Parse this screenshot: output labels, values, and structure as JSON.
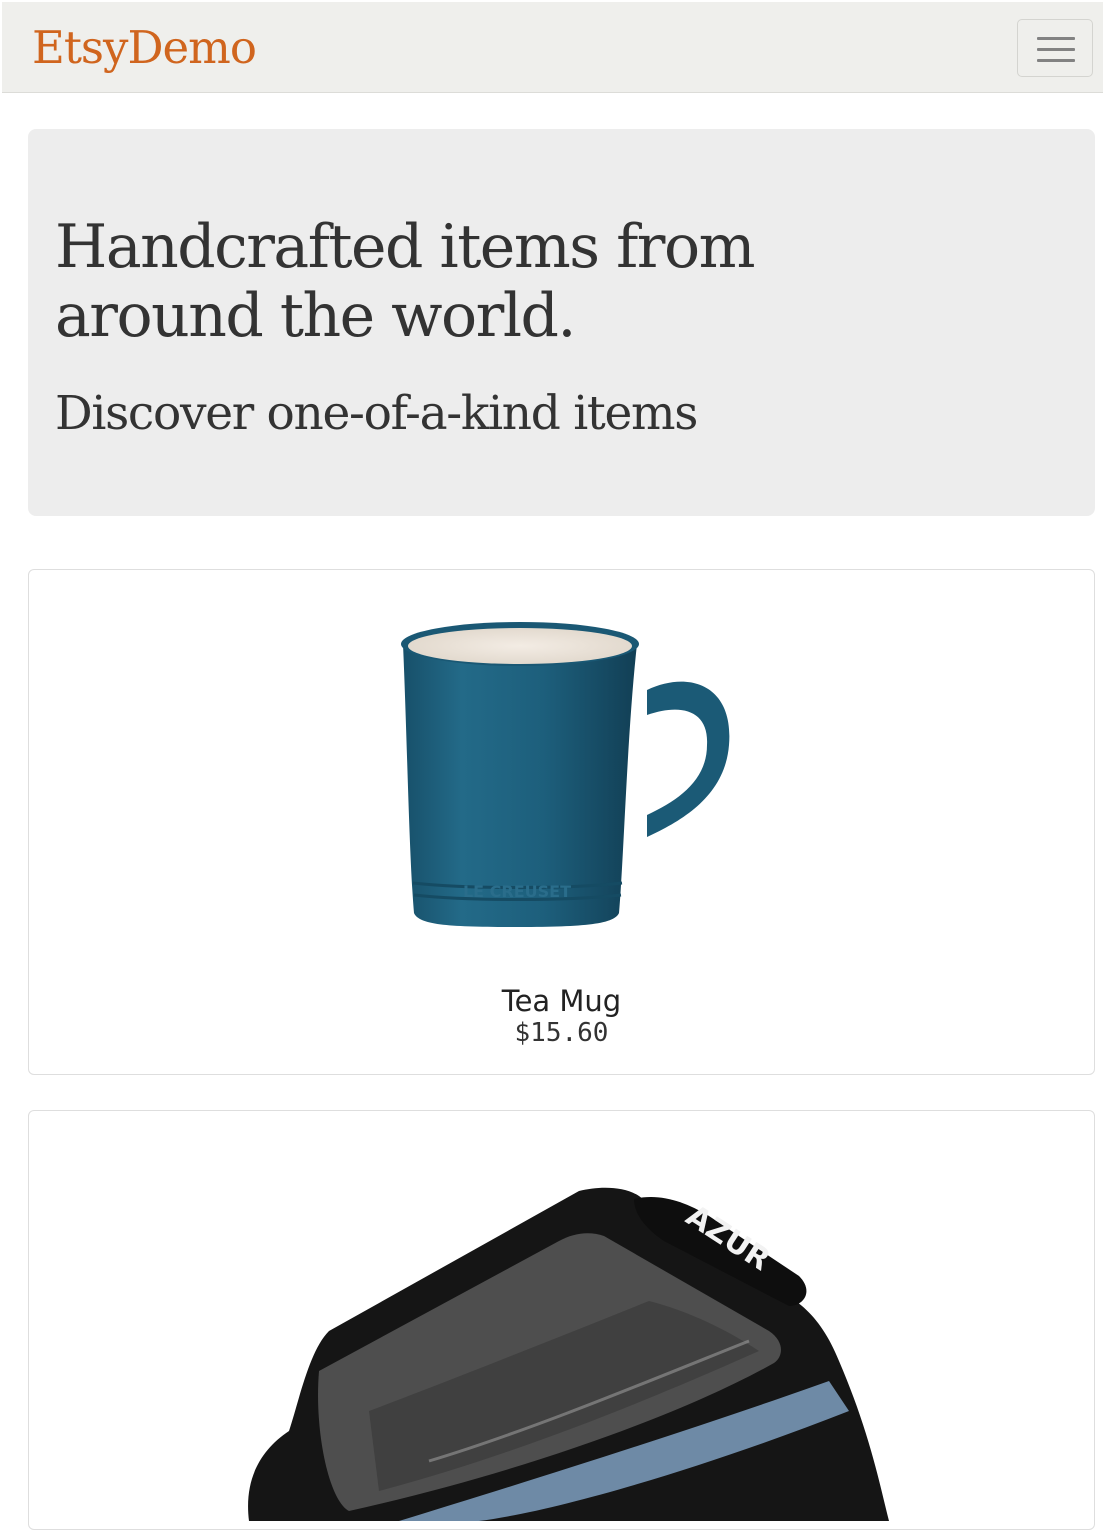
{
  "navbar": {
    "brand": "EtsyDemo",
    "menu_icon": "hamburger-menu-icon"
  },
  "hero": {
    "heading": "Handcrafted items from around the world.",
    "subheading": "Discover one-of-a-kind items"
  },
  "products": [
    {
      "name": "Tea Mug",
      "price": "$15.60",
      "image": "blue-ceramic-mug-image",
      "image_text": "LE CREUSET"
    },
    {
      "name": "",
      "price": "",
      "image": "bike-frame-bag-image",
      "image_text": "AZUR"
    }
  ],
  "colors": {
    "brand": "#d0651e",
    "navbar_bg": "#efefec",
    "hero_bg": "#ededed",
    "text": "#333333"
  }
}
